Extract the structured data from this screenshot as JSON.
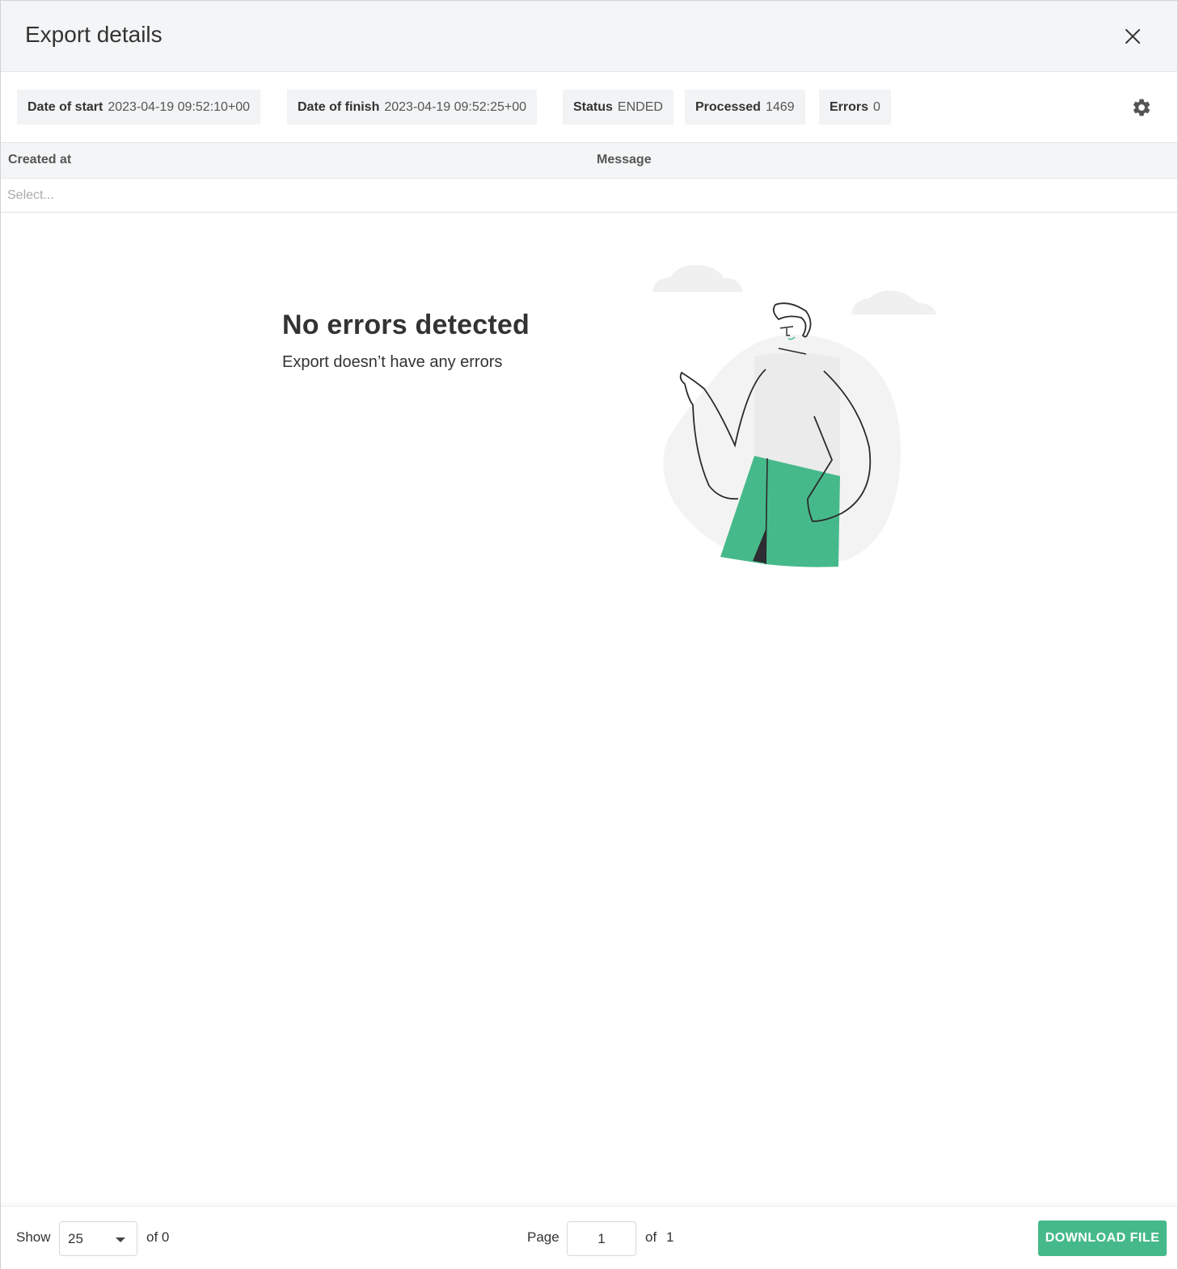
{
  "modal": {
    "title": "Export details"
  },
  "stats": [
    {
      "label": "Date of start",
      "value": "2023-04-19 09:52:10+00"
    },
    {
      "label": "Date of finish",
      "value": "2023-04-19 09:52:25+00"
    },
    {
      "label": "Status",
      "value": "ENDED"
    },
    {
      "label": "Processed",
      "value": "1469"
    },
    {
      "label": "Errors",
      "value": "0"
    }
  ],
  "table": {
    "columns": [
      "Created at",
      "Message"
    ],
    "filter_placeholder": "Select..."
  },
  "empty_state": {
    "title": "No errors detected",
    "subtitle": "Export doesn’t have any errors"
  },
  "footer": {
    "show_label": "Show",
    "page_size": "25",
    "of_total": "of 0",
    "page_label": "Page",
    "current_page": "1",
    "of_label": "of",
    "total_pages": "1",
    "download_label": "DOWNLOAD FILE"
  },
  "colors": {
    "accent": "#46b98a",
    "header_bg": "#f4f5f6",
    "chip_bg": "#f2f3f4"
  },
  "icons": {
    "close": "close-icon",
    "settings": "gear-icon",
    "dropdown": "chevron-down-icon"
  }
}
